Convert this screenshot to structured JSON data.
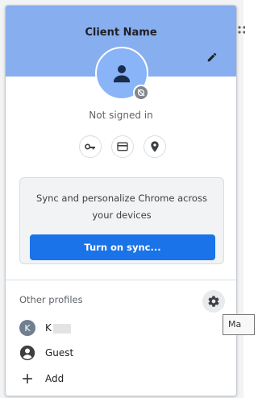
{
  "header": {
    "client_name": "Client Name",
    "edit_icon": "pencil-icon",
    "color": "#87aeef"
  },
  "profile": {
    "avatar_icon": "person-icon",
    "badge_icon": "sync-off-icon",
    "status": "Not signed in"
  },
  "quick_actions": [
    {
      "name": "passwords",
      "icon": "key-icon"
    },
    {
      "name": "payment-methods",
      "icon": "credit-card-icon"
    },
    {
      "name": "addresses",
      "icon": "location-pin-icon"
    }
  ],
  "sync": {
    "message": "Sync and personalize Chrome across your devices",
    "button_label": "Turn on sync...",
    "button_color": "#1a73e8"
  },
  "other_profiles": {
    "label": "Other profiles",
    "settings_icon": "gear-icon",
    "items": [
      {
        "initial": "K",
        "label": "K"
      },
      {
        "label": "Guest",
        "icon": "person-circle-icon"
      },
      {
        "label": "Add",
        "icon": "plus-icon"
      }
    ]
  },
  "tooltip": {
    "text": "Ma"
  }
}
